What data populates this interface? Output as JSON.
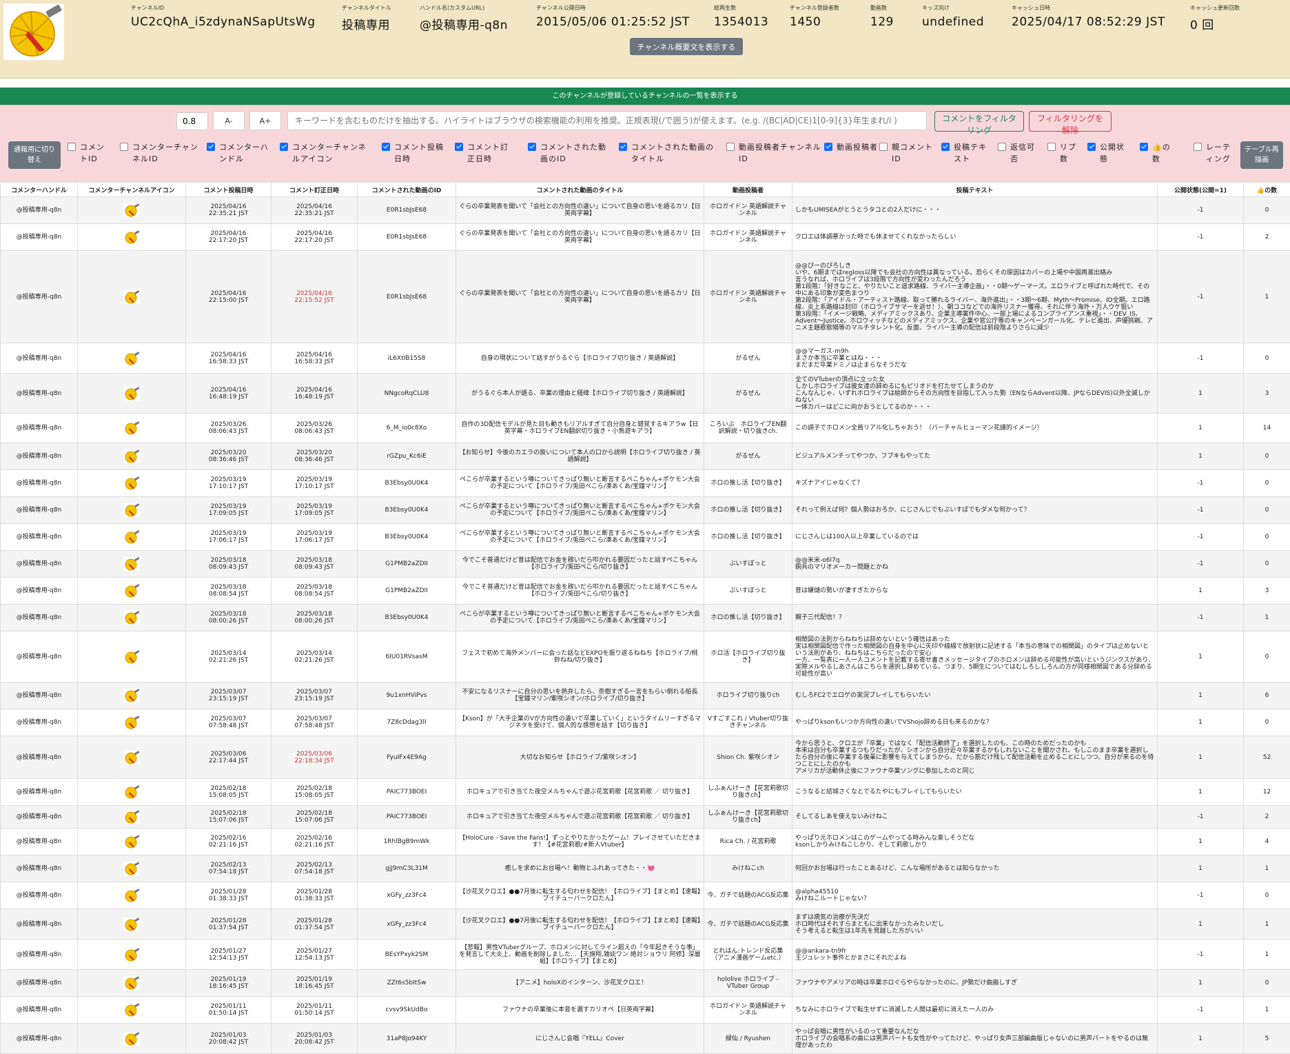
{
  "channel": {
    "fields": [
      {
        "label": "チャンネルID",
        "value": "UC2cQhA_i5zdynaNSapUtsWg"
      },
      {
        "label": "チャンネルタイトル",
        "value": "投稿専用"
      },
      {
        "label": "ハンドル名(カスタムURL)",
        "value": "@投稿専用-q8n"
      },
      {
        "label": "チャンネル公開日時",
        "value": "2015/05/06 01:25:52 JST"
      },
      {
        "label": "総再生数",
        "value": "1354013"
      },
      {
        "label": "チャンネル登録者数",
        "value": "1450"
      },
      {
        "label": "動画数",
        "value": "129"
      },
      {
        "label": "キッズ向け",
        "value": "undefined"
      },
      {
        "label": "キャッシュ日時",
        "value": "2025/04/17 08:52:29 JST"
      },
      {
        "label": "キャッシュ更新回数",
        "value": "0 回"
      }
    ],
    "show_description_button": "チャンネル概要文を表示する"
  },
  "subscriptions_bar": "このチャンネルが登録しているチャンネルの一覧を表示する",
  "filter": {
    "zoom_value": "0.8",
    "font_decrease_label": "A-",
    "font_increase_label": "A+",
    "keyword_placeholder": "キーワードを含むものだけを抽出する。ハイライトはブラウザの検索機能の利用を推奨。正規表現(/で囲う)が使えます。(e.g. /(BC|AD|CE)1[0-9]{3}年生まれ/i )",
    "filter_button": "コメントをフィルタリング",
    "clear_button": "フィルタリングを解除",
    "switch_button": "通報用に切り替え",
    "redraw_button": "テーブル再描画",
    "column_toggles": [
      {
        "label": "コメントID",
        "checked": false
      },
      {
        "label": "コメンターチャンネルID",
        "checked": false
      },
      {
        "label": "コメンターハンドル",
        "checked": true
      },
      {
        "label": "コメンターチャンネルアイコン",
        "checked": true
      },
      {
        "label": "コメント投稿日時",
        "checked": true
      },
      {
        "label": "コメント訂正日時",
        "checked": true
      },
      {
        "label": "コメントされた動画のID",
        "checked": true
      },
      {
        "label": "コメントされた動画のタイトル",
        "checked": true
      },
      {
        "label": "動画投稿者チャンネルID",
        "checked": false
      },
      {
        "label": "動画投稿者",
        "checked": true
      },
      {
        "label": "親コメントID",
        "checked": false
      },
      {
        "label": "投稿テキスト",
        "checked": true
      },
      {
        "label": "返信可否",
        "checked": false
      },
      {
        "label": "リプ数",
        "checked": false
      },
      {
        "label": "公開状態",
        "checked": true
      },
      {
        "label": "👍の数",
        "checked": true
      },
      {
        "label": "レーティング",
        "checked": false
      }
    ]
  },
  "table": {
    "headers": [
      "コメンターハンドル",
      "コメンターチャンネルアイコン",
      "コメント投稿日時",
      "コメント訂正日時",
      "コメントされた動画のID",
      "コメントされた動画のタイトル",
      "動画投稿者",
      "投稿テキスト",
      "公開状態(公開=1)",
      "👍の数"
    ],
    "rows": [
      {
        "handle": "@投稿専用-q8n",
        "posted": "2025/04/16\n22:35:21 JST",
        "edited": "2025/04/16\n22:35:21 JST",
        "edited_red": false,
        "video_id": "E0R1sbJsE68",
        "title": "ぐらの卒業発表を聞いて「会社との方向性の違い」について自身の思いを語るカリ【日英両字幕】",
        "uploader": "ホロガイドン 英語解説チャンネル",
        "text": "しかもUMISEAがとうとうタコとの2人だけに・・・",
        "public": "-1",
        "likes": "0",
        "h": 39
      },
      {
        "handle": "@投稿専用-q8n",
        "posted": "2025/04/16\n22:17:20 JST",
        "edited": "2025/04/16\n22:17:20 JST",
        "edited_red": false,
        "video_id": "E0R1sbJsE68",
        "title": "ぐらの卒業発表を聞いて「会社との方向性の違い」について自身の思いを語るカリ【日英両字幕】",
        "uploader": "ホロガイドン 英語解説チャンネル",
        "text": "クロエは体調悪かった時でも休ませてくれなかったらしい",
        "public": "-1",
        "likes": "2",
        "h": 39
      },
      {
        "handle": "@投稿専用-q8n",
        "posted": "2025/04/16\n22:15:00 JST",
        "edited": "2025/04/16\n22:15:52 JST",
        "edited_red": true,
        "video_id": "E0R1sbJsE68",
        "title": "ぐらの卒業発表を聞いて「会社との方向性の違い」について自身の思いを語るカリ【日英両字幕】",
        "uploader": "ホロガイドン 英語解説チャンネル",
        "text": "@@ぴーのぴろしき\nいや、6期まではregloss以降でも会社の方向性は異なっている。恐らくその原因はカバーの上場や中国再進出絡み\n言うなれば、ホロライブは3段階で方向性が変わったんだろう\n第1段階：「好きなこと、やりたいこと追求路線、ライバー主導企画」・・0期〜ゲーマーズ。エロライブと呼ばれた時代で、その中にある印象が変色まつり\n第2段階：「アイドル・アーティスト路線、取って勝れるライバー、海外進出」・・3期〜6期、Myth〜Promise、ID全期。エロ路線、炎上系路線は封印（ホロライブサマーを返せ！）、朝ココなどでの海外リスナー獲得、それに伴う海外・万人ウケ狙い\n第3段階：「イメージ戦略、メディアミックスあり、企業主導案件中心、一部上場によるコンプライアンス重視」・・DEV_IS、Advent〜Justice。ホロウィッチなどのメディアミックス、企業や官公庁等のキャンペーンガール化、テレビ進出、声優挑戦、アニメ主題歌歌唱等のマルチタレント化。反面、ライバー主導の配信は前段階よりさらに減少",
        "public": "-1",
        "likes": "1",
        "h": 134
      },
      {
        "handle": "@投稿専用-q8n",
        "posted": "2025/04/16\n16:58:33 JST",
        "edited": "2025/04/16\n16:58:33 JST",
        "edited_red": false,
        "video_id": "iL6XtIB15S8",
        "title": "自身の現状について話すがうるぐら【ホロライブ切り抜き / 英語解説】",
        "uploader": "がるぜん",
        "text": "@@マーガス-m9h\nまさか本当に卒業とはね・・・\nまだまだ卒業ドミノは止まらなそうだな",
        "public": "-1",
        "likes": "0",
        "h": 44
      },
      {
        "handle": "@投稿専用-q8n",
        "posted": "2025/04/16\n16:48:19 JST",
        "edited": "2025/04/16\n16:48:19 JST",
        "edited_red": false,
        "video_id": "NNgcoRqCLU8",
        "title": "がうるぐら本人が語る、卒業の理由と経緯【ホロライブ切り抜き / 英語解説】",
        "uploader": "がるぜん",
        "text": "全てのVTuberの頂点に立った女\nしかしホロライブは彼女達の辞めるにもピリオドを打たせてしまうのか\nこんなんじゃ、いずれホロライブは絵師からその方向性を目指して入った勢（ENならAdvent以降、JPならDEVIS)以外全滅しかねない\n一体カバーはどこに向かおうとしてるのか・・・",
        "public": "1",
        "likes": "3",
        "h": 58
      },
      {
        "handle": "@投稿専用-q8n",
        "posted": "2025/03/26\n08:06:43 JST",
        "edited": "2025/03/26\n08:06:43 JST",
        "edited_red": false,
        "video_id": "6_M_io0c8Xo",
        "title": "自作の3D配信モデルが見た目も動きもリアルすぎて自分自身と錯覚するキアラw【日英字幕・ホロライブEN翻訳切り抜き・小鳥遊キアラ】",
        "uploader": "ころいぶ　ホロライブEN翻訳解説・切り抜きch.",
        "text": "この調子でホロメン全員リアル化しちゃおう！（バーチャルヒューマン花譜的イメージ）",
        "public": "1",
        "likes": "14",
        "h": 43
      },
      {
        "handle": "@投稿専用-q8n",
        "posted": "2025/03/20\n08:36:46 JST",
        "edited": "2025/03/20\n08:36:46 JST",
        "edited_red": false,
        "video_id": "rGZpu_Kc6iE",
        "title": "【お知らせ】今後のカエラの扱いについて本人の口から説明【ホロライブ切り抜き / 英語解説】",
        "uploader": "がるぜん",
        "text": "ビジュアルメンチってやつか、フブキもやってた",
        "public": "1",
        "likes": "0",
        "h": 39
      },
      {
        "handle": "@投稿専用-q8n",
        "posted": "2025/03/19\n17:10:17 JST",
        "edited": "2025/03/19\n17:10:17 JST",
        "edited_red": false,
        "video_id": "B3Ebsy0U0K4",
        "title": "ぺこらが卒業するという噂についてきっぱり無いと断言するぺこちゃん+ポケモン大会の予定について【ホロライブ/兎田ぺこら/湊あくあ/宝鐘マリン】",
        "uploader": "ホロの推し活【切り抜き】",
        "text": "キズナアイじゃなくて？",
        "public": "-1",
        "likes": "0",
        "h": 39
      },
      {
        "handle": "@投稿専用-q8n",
        "posted": "2025/03/19\n17:09:05 JST",
        "edited": "2025/03/19\n17:09:05 JST",
        "edited_red": false,
        "video_id": "B3Ebsy0U0K4",
        "title": "ぺこらが卒業するという噂についてきっぱり無いと断言するぺこちゃん+ポケモン大会の予定について【ホロライブ/兎田ぺこら/湊あくあ/宝鐘マリン】",
        "uploader": "ホロの推し活【切り抜き】",
        "text": "それって例えば何？個人勢はおろか、にじさんじでもぶいすぽでもダメな何かって？",
        "public": "-1",
        "likes": "0",
        "h": 39
      },
      {
        "handle": "@投稿専用-q8n",
        "posted": "2025/03/19\n17:06:17 JST",
        "edited": "2025/03/19\n17:06:17 JST",
        "edited_red": false,
        "video_id": "B3Ebsy0U0K4",
        "title": "ぺこらが卒業するという噂についてきっぱり無いと断言するぺこちゃん+ポケモン大会の予定について【ホロライブ/兎田ぺこら/湊あくあ/宝鐘マリン】",
        "uploader": "ホロの推し活【切り抜き】",
        "text": "にじさんじは100人以上卒業しているのでは",
        "public": "-1",
        "likes": "0",
        "h": 39
      },
      {
        "handle": "@投稿専用-q8n",
        "posted": "2025/03/18\n08:09:43 JST",
        "edited": "2025/03/18\n08:09:43 JST",
        "edited_red": false,
        "video_id": "G1PMB2aZDII",
        "title": "今でこそ普通だけど昔は配信でお金を稼いだら叩かれる要因だったと話すぺこちゃん【ホロライブ/兎田ぺこら/切り抜き】",
        "uploader": "ぶいすぽっと",
        "text": "@@米米-o6l7q\n銅兵のマリオメーカー問題とかね",
        "public": "-1",
        "likes": "0",
        "h": 39
      },
      {
        "handle": "@投稿専用-q8n",
        "posted": "2025/03/18\n08:08:54 JST",
        "edited": "2025/03/18\n08:08:54 JST",
        "edited_red": false,
        "video_id": "G1PMB2aZDII",
        "title": "今でこそ普通だけど昔は配信でお金を稼いだら叩かれる要因だったと話すぺこちゃん【ホロライブ/兎田ぺこら/切り抜き】",
        "uploader": "ぶいすぽっと",
        "text": "昔は嫌儲の勢いが凄すぎたからな",
        "public": "1",
        "likes": "3",
        "h": 39
      },
      {
        "handle": "@投稿専用-q8n",
        "posted": "2025/03/18\n08:00:26 JST",
        "edited": "2025/03/18\n08:00:26 JST",
        "edited_red": false,
        "video_id": "B3Ebsy0U0K4",
        "title": "ぺこらが卒業するという噂についてきっぱり無いと断言するぺこちゃん+ポケモン大会の予定について【ホロライブ/兎田ぺこら/湊あくあ/宝鐘マリン】",
        "uploader": "ホロの推し活【切り抜き】",
        "text": "親子三代配信！？",
        "public": "-1",
        "likes": "1",
        "h": 39
      },
      {
        "handle": "@投稿専用-q8n",
        "posted": "2025/03/14\n02:21:26 JST",
        "edited": "2025/03/14\n02:21:26 JST",
        "edited_red": false,
        "video_id": "6IU01RVsasM",
        "title": "フェスで初めて海外メンバーに会った話などEXPOを振り返るねねち【ホロライブ/桃鈴ねね/切り抜き】",
        "uploader": "ホロ活【ホロライブ切り抜き】",
        "text": "相関図の法則からねねちは辞めないという確信はあった\n実は相関図配信で作った相関図の自身を中心に矢印や線線で放射状に記述する「本当の意味での相関図」のタイプは止めないという法則があり、ねねちはこちらだったので安心\n一方、一覧表に一人一人コメントを記載する寄せ書きメッセージタイプのホロメンは辞める可能性が高いというジンクスがあり、実際メルやるしあさんはこちらを選択し辞めている。つまり、5期生についてはむしろししろんの方が同様相関図である分辞める可能性が高い",
        "public": "1",
        "likes": "0",
        "h": 74
      },
      {
        "handle": "@投稿専用-q8n",
        "posted": "2025/03/07\n23:15:19 JST",
        "edited": "2025/03/07\n23:15:19 JST",
        "edited_red": false,
        "video_id": "9u1xnHViPvs",
        "title": "不安になるリスナーに自分の思いを熱弁したら、奈樹すぎる一言をもらい倒れる船長【宝鐘マリン/紫咲シオン/ホロライブ/切り抜き】",
        "uploader": "ホロライブ切り抜りch",
        "text": "むしろFC2でエロゲの実況プレイしてもらいたい",
        "public": "1",
        "likes": "6",
        "h": 39
      },
      {
        "handle": "@投稿専用-q8n",
        "posted": "2025/03/07\n07:58:48 JST",
        "edited": "2025/03/07\n07:58:48 JST",
        "edited_red": false,
        "video_id": "7Z8cDdag3lI",
        "title": "【Kson】が「大手企業のVが方向性の違いで卒業していく」というタイムリーすぎるマジネタを受けて、個人的な感想を話す【切り抜き】",
        "uploader": "Vすごすこれ / Vtuber切り抜きチャンネル",
        "text": "やっぱりksonもいつか方向性の違いでVShojo辞める日も来るのかな？",
        "public": "1",
        "likes": "0",
        "h": 39
      },
      {
        "handle": "@投稿専用-q8n",
        "posted": "2025/03/06\n22:17:44 JST",
        "edited": "2025/03/06\n22:18:34 JST",
        "edited_red": true,
        "video_id": "FyuIFx4E9Ag",
        "title": "大切なお知らせ【ホロライブ/紫咲シオン】",
        "uploader": "Shion Ch. 紫咲シオン",
        "text": "今から思うと、クロエが「卒業」ではなく「配信活動終了」を選択したのも、この時のためだったのかも\n本来は自分も卒業するつもりだったが、シオンから自分近々卒業するかもしれないことを聞かされ、もしこのまま卒業を選択したら自分の後に卒業する後輩に影響を与えてしまうから、だから筋だけ残して配信活動を止めることにしつつ、自分が来るのを待つことにしたのかも\nアメリカが活動休止後にファウナ卒業ソングに参加したのと同じ",
        "public": "1",
        "likes": "52",
        "h": 62
      },
      {
        "handle": "@投稿専用-q8n",
        "posted": "2025/02/18\n15:08:05 JST",
        "edited": "2025/02/18\n15:08:05 JST",
        "edited_red": false,
        "video_id": "PAIC773BOEI",
        "title": "ホロキュアで引き当てた夜空メルちゃんで遊ぶ花宮莉歌【花宮莉歌 ／ 切り抜き】",
        "uploader": "しふぁんけーき【花宮莉歌切り抜きch】",
        "text": "こうなると結城さくなとでるたやにもプレイしてもらいたい",
        "public": "1",
        "likes": "12",
        "h": 39
      },
      {
        "handle": "@投稿専用-q8n",
        "posted": "2025/02/18\n15:07:06 JST",
        "edited": "2025/02/18\n15:07:06 JST",
        "edited_red": false,
        "video_id": "PAIC773BOEI",
        "title": "ホロキュアで引き当てた夜空メルちゃんで遊ぶ花宮莉歌【花宮莉歌 ／ 切り抜き】",
        "uploader": "しふぁんけーき【花宮莉歌切り抜きch】",
        "text": "そしてるしあを使えないみけねこ",
        "public": "-1",
        "likes": "2",
        "h": 33
      },
      {
        "handle": "@投稿専用-q8n",
        "posted": "2025/02/16\n02:21:16 JST",
        "edited": "2025/02/16\n02:21:16 JST",
        "edited_red": false,
        "video_id": "1RhlBgB9mWk",
        "title": "【HoloCure - Save the Fans!】ずっとやりたかったゲーム！プレイさせていただきます！【#花宮莉歌/#新人Vtuber】",
        "uploader": "Rica Ch. / 花宮莉歌",
        "text": "やっぱり元ホロメンはこのゲームやってる時みんな楽しそうだな\nksonしかりみけねこしかり、そして莉歌しかり",
        "public": "1",
        "likes": "4",
        "h": 39
      },
      {
        "handle": "@投稿専用-q8n",
        "posted": "2025/02/13\n07:54:18 JST",
        "edited": "2025/02/13\n07:54:18 JST",
        "edited_red": false,
        "video_id": "gjJ9mC3L31M",
        "title": "癒しを求めにお台場へ！動物とふれあってきた・・💓",
        "uploader": "みけねこch",
        "text": "何回かお台場は行ったことあるけど、こんな場所があるとは知らなかった",
        "public": "1",
        "likes": "1",
        "h": 39
      },
      {
        "handle": "@投稿専用-q8n",
        "posted": "2025/01/28\n01:38:33 JST",
        "edited": "2025/01/28\n01:38:33 JST",
        "edited_red": false,
        "video_id": "xGFy_zz3Fc4",
        "title": "【沙花叉クロエ】●●7月後に転生する匂わせを配信！【ホロライブ】【まとめ】【速報】ブイチューバークロたん】",
        "uploader": "今、ガチで話題のACG反応集",
        "text": "@alpha45510\nみけねこルートじゃない？",
        "public": "-1",
        "likes": "0",
        "h": 39
      },
      {
        "handle": "@投稿専用-q8n",
        "posted": "2025/01/28\n01:37:54 JST",
        "edited": "2025/01/28\n01:37:54 JST",
        "edited_red": false,
        "video_id": "xGFy_zz3Fc4",
        "title": "【沙花叉クロエ】●●7月後に転生する匂わせを配信！【ホロライブ】【まとめ】【速報】ブイチューバークロたん】",
        "uploader": "今、ガチで話題のACG反応集",
        "text": "まずは病気の治療が先決だ\nホロ時代はそれすらまともに出来なかったみたいだし\nそう考えると転生は1年先を見越した方がいい",
        "public": "1",
        "likes": "1",
        "h": 44
      },
      {
        "handle": "@投稿専用-q8n",
        "posted": "2025/01/27\n12:54:13 JST",
        "edited": "2025/01/27\n12:54:13 JST",
        "edited_red": false,
        "video_id": "BEsYPxyk2SM",
        "title": "【悲報】男性VTuberグループ、ホロメンに対してライン超えの「今年起きそうな事」を発言して大炎上、動画を削除しました…【天旗翔,雑談ワン 絶対ショウリ 阿修】深層組】【ホロライブ】【まとめ】",
        "uploader": "とれはん:トレンド反応集（アニメ漫画ゲームetc.）",
        "text": "@@ankara-tn9fr\n王ジュレット事件とかまさにそれだよね",
        "public": "-1",
        "likes": "1",
        "h": 44
      },
      {
        "handle": "@投稿専用-q8n",
        "posted": "2025/01/19\n18:16:45 JST",
        "edited": "2025/01/19\n18:16:45 JST",
        "edited_red": false,
        "video_id": "ZZt6s5bItSw",
        "title": "【アニメ】holoXのインターン、沙花叉クロエ！",
        "uploader": "hololive ホロライブ - VTuber Group",
        "text": "ファウナやアメリアの時は卒業ホロぐらやらなかったのに、JP勢だけ曲扇しすぎ",
        "public": "1",
        "likes": "0",
        "h": 39
      },
      {
        "handle": "@投稿専用-q8n",
        "posted": "2025/01/11\n01:50:14 JST",
        "edited": "2025/01/11\n01:50:14 JST",
        "edited_red": false,
        "video_id": "cvsv9SkUdBo",
        "title": "ファウナの卒業後に本音を漏すカリオペ【日英両字幕】",
        "uploader": "ホロガイドン 英語解説チャンネル",
        "text": "ちなみにホロライブで転生せずに消滅した人間は最初に消えた一人のみ",
        "public": "-1",
        "likes": "1",
        "h": 39
      },
      {
        "handle": "@投稿専用-q8n",
        "posted": "2025/01/03\n20:08:42 JST",
        "edited": "2025/01/03\n20:08:42 JST",
        "edited_red": false,
        "video_id": "31aP8Jo94KY",
        "title": "にじさんじ会唱『YELL』Cover",
        "uploader": "緑仙 / Ryushen",
        "text": "やっぱ会唱に男性がいるのって重要なんだな\nホロライブの会唱系の曲には男声パートも女性がやってたけど、やっぱり女声三部編曲版じゃないのに男声パートをやるのは無理があったわ",
        "public": "1",
        "likes": "5",
        "h": 44
      }
    ]
  }
}
